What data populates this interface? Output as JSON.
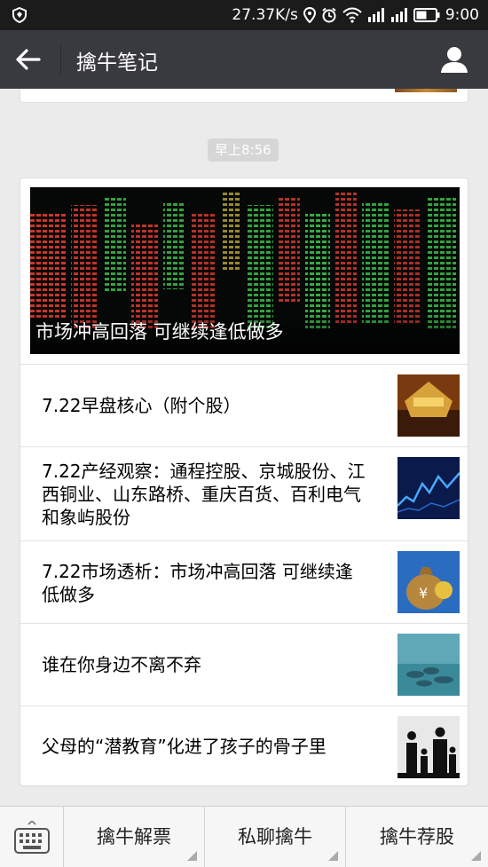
{
  "status_bar": {
    "network_speed": "27.37K/s",
    "time": "9:00"
  },
  "header": {
    "title": "擒牛笔记"
  },
  "timestamp": "早上8:56",
  "article_card": {
    "hero_title": "市场冲高回落 可继续逢低做多",
    "items": [
      {
        "title": "7.22早盘核心（附个股）",
        "thumb_icon": "gold-logo-thumbnail"
      },
      {
        "title": "7.22产经观察：通程控股、京城股份、江西铜业、山东路桥、重庆百货、百利电气和象屿股份",
        "thumb_icon": "stock-chart-thumbnail"
      },
      {
        "title": "7.22市场透析：市场冲高回落 可继续逢低做多",
        "thumb_icon": "money-bag-thumbnail"
      },
      {
        "title": "谁在你身边不离不弃",
        "thumb_icon": "stones-thumbnail"
      },
      {
        "title": "父母的“潜教育”化进了孩子的骨子里",
        "thumb_icon": "family-silhouette-thumbnail"
      }
    ]
  },
  "bottom_menu": {
    "items": [
      {
        "label": "擒牛解票"
      },
      {
        "label": "私聊擒牛"
      },
      {
        "label": "擒牛荐股"
      }
    ]
  },
  "colors": {
    "header_bg": "#393a3f",
    "status_bg": "#1b1b1b",
    "chat_bg": "#ebebeb"
  }
}
